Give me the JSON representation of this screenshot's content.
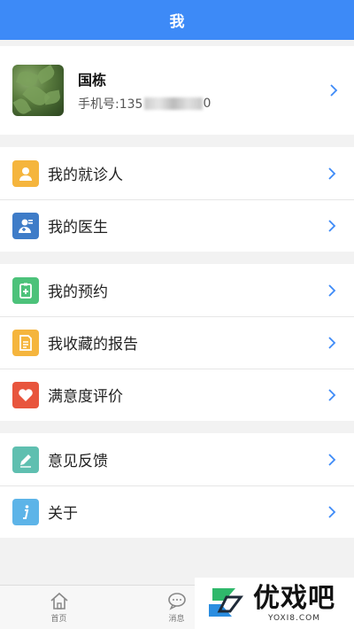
{
  "header": {
    "title": "我"
  },
  "profile": {
    "name": "国栋",
    "phone_prefix": "手机号:135",
    "phone_suffix": "0"
  },
  "group1": [
    {
      "label": "我的就诊人",
      "icon": "patient-icon",
      "color": "#f5b53d"
    },
    {
      "label": "我的医生",
      "icon": "doctor-icon",
      "color": "#3e7cc8"
    }
  ],
  "group2": [
    {
      "label": "我的预约",
      "icon": "appointment-icon",
      "color": "#4cc27a"
    },
    {
      "label": "我收藏的报告",
      "icon": "report-icon",
      "color": "#f5b53d"
    },
    {
      "label": "满意度评价",
      "icon": "heart-icon",
      "color": "#e8553d"
    }
  ],
  "group3": [
    {
      "label": "意见反馈",
      "icon": "pencil-icon",
      "color": "#5fbfb0"
    },
    {
      "label": "关于",
      "icon": "info-icon",
      "color": "#5db4e8"
    }
  ],
  "tabbar": {
    "tabs": [
      {
        "label": "首页",
        "icon": "home-icon"
      },
      {
        "label": "消息",
        "icon": "message-icon"
      }
    ]
  },
  "watermark": {
    "text": "优戏吧",
    "url": "YOXI8.COM"
  },
  "colors": {
    "primary": "#3d8af7",
    "chevron": "#3d8af7"
  }
}
